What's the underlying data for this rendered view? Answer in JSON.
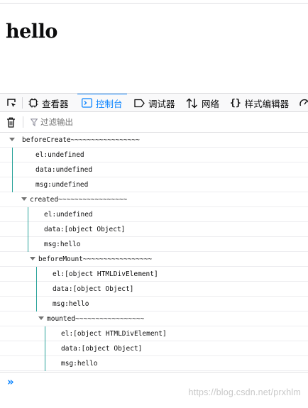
{
  "page": {
    "heading": "hello"
  },
  "devtools": {
    "tabs": [
      {
        "label": "查看器",
        "icon": "inspector-icon"
      },
      {
        "label": "控制台",
        "icon": "console-icon",
        "selected": true
      },
      {
        "label": "调试器",
        "icon": "debugger-icon"
      },
      {
        "label": "网络",
        "icon": "network-icon"
      },
      {
        "label": "样式编辑器",
        "icon": "style-editor-icon"
      }
    ],
    "filter_placeholder": "过滤输出",
    "accent": "#0a84ff"
  },
  "console": {
    "groups": [
      {
        "title": "beforeCreate~~~~~~~~~~~~~~~~~",
        "lines": [
          "el:undefined",
          "data:undefined",
          "msg:undefined"
        ]
      },
      {
        "title": "created~~~~~~~~~~~~~~~~~",
        "lines": [
          "el:undefined",
          "data:[object Object]",
          "msg:hello"
        ]
      },
      {
        "title": "beforeMount~~~~~~~~~~~~~~~~~",
        "lines": [
          "el:[object HTMLDivElement]",
          "data:[object Object]",
          "msg:hello"
        ]
      },
      {
        "title": "mounted~~~~~~~~~~~~~~~~~",
        "lines": [
          "el:[object HTMLDivElement]",
          "data:[object Object]",
          "msg:hello"
        ]
      }
    ],
    "prompt_symbol": "»"
  },
  "watermark": "https://blog.csdn.net/prxhlm"
}
